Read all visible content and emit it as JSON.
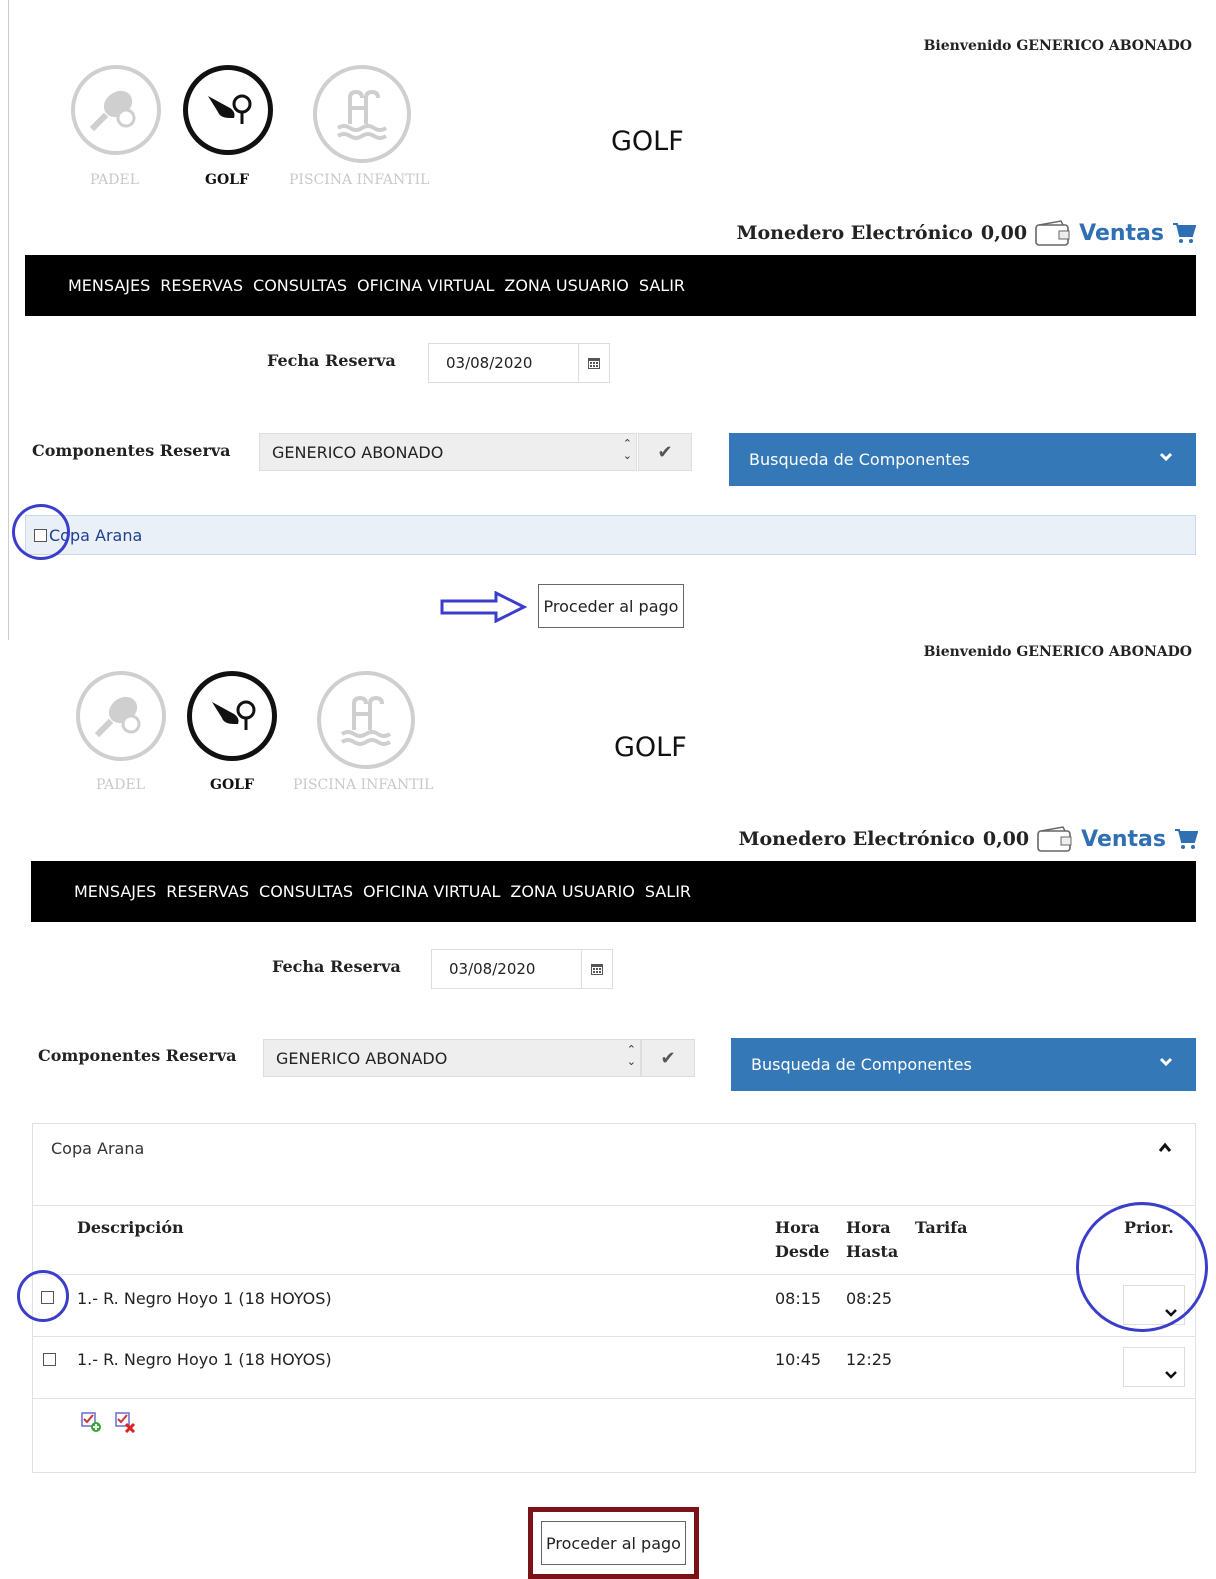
{
  "header": {
    "welcome": "Bienvenido GENERICO ABONADO",
    "page_title": "GOLF"
  },
  "sports": [
    {
      "label": "PADEL",
      "icon": "padel-racket-icon",
      "active": false
    },
    {
      "label": "GOLF",
      "icon": "golf-club-icon",
      "active": true
    },
    {
      "label": "PISCINA INFANTIL",
      "icon": "pool-icon",
      "active": false
    }
  ],
  "wallet": {
    "label": "Monedero Electrónico",
    "amount": "0,00",
    "ventas": "Ventas"
  },
  "nav": {
    "items": [
      "MENSAJES",
      "RESERVAS",
      "CONSULTAS",
      "OFICINA VIRTUAL",
      "ZONA USUARIO",
      "SALIR"
    ]
  },
  "form": {
    "fecha_label": "Fecha Reserva",
    "fecha_value": "03/08/2020",
    "componentes_label": "Componentes Reserva",
    "componentes_value": "GENERICO ABONADO",
    "busqueda_label": "Busqueda de Componentes"
  },
  "top": {
    "copa_label": "Copa Arana",
    "proceed_label": "Proceder al pago"
  },
  "bottom": {
    "panel_title": "Copa Arana",
    "columns": {
      "descripcion": "Descripción",
      "hora": "Hora",
      "desde": "Desde",
      "hasta": "Hasta",
      "tarifa": "Tarifa",
      "prior": "Prior."
    },
    "rows": [
      {
        "descripcion": "1.- R. Negro Hoyo 1 (18 HOYOS)",
        "desde": "08:15",
        "hasta": "08:25"
      },
      {
        "descripcion": "1.- R. Negro Hoyo 1 (18 HOYOS)",
        "desde": "10:45",
        "hasta": "12:25"
      }
    ],
    "proceed_label": "Proceder al pago"
  },
  "colors": {
    "accent": "#3478b8",
    "annotation": "#3b3ecb",
    "highlight_box": "#7a1318"
  }
}
